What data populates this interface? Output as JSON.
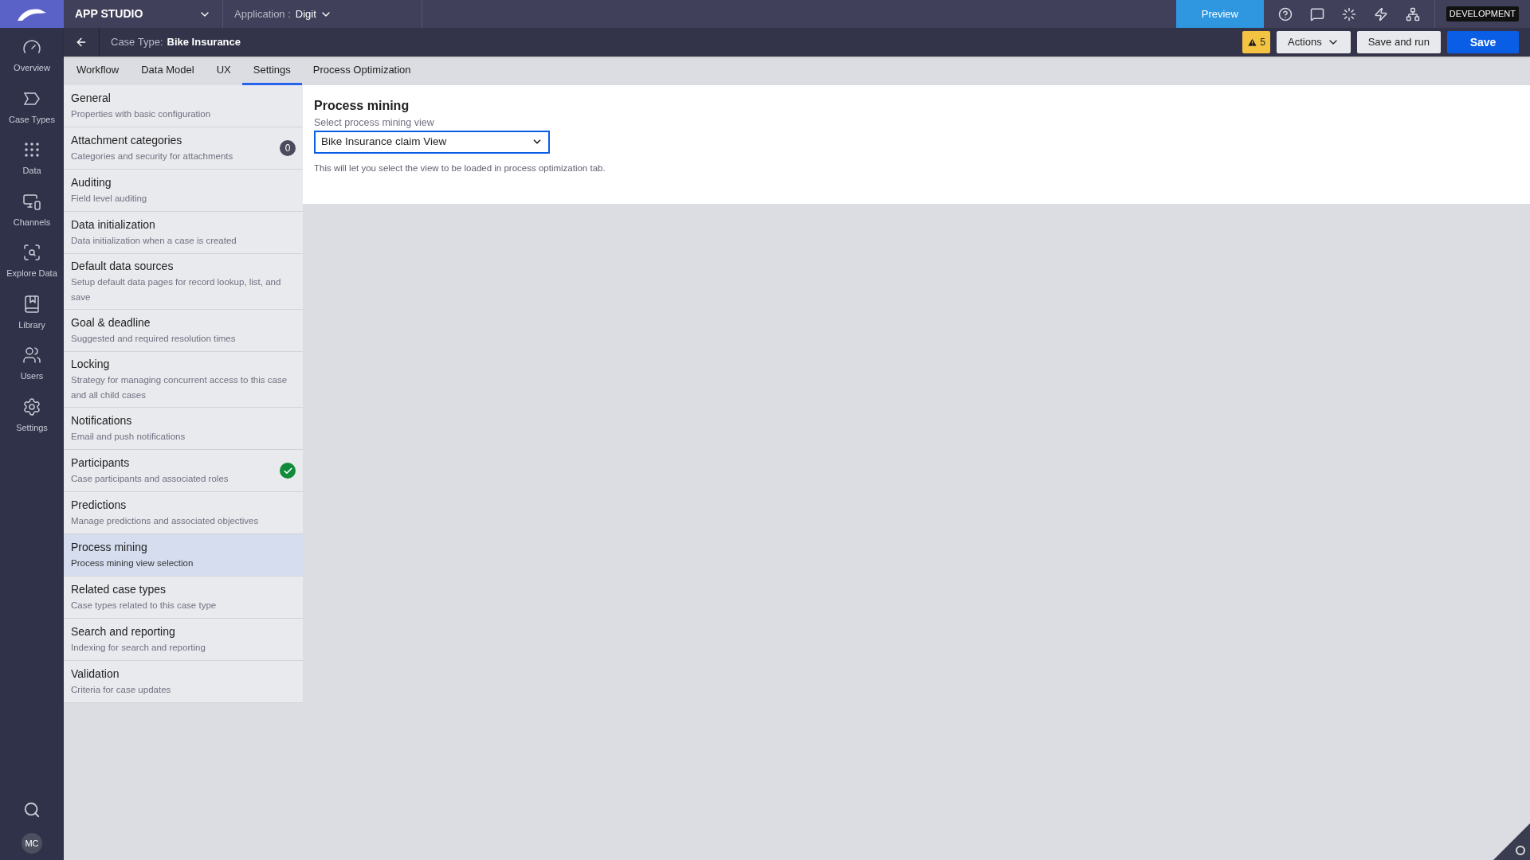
{
  "header": {
    "studio": "APP STUDIO",
    "application_label": "Application :",
    "application": "Digit",
    "preview": "Preview",
    "environment": "DEVELOPMENT"
  },
  "rail": {
    "items": [
      {
        "label": "Overview",
        "kind": "gauge"
      },
      {
        "label": "Case Types",
        "kind": "tag"
      },
      {
        "label": "Data",
        "kind": "grid"
      },
      {
        "label": "Channels",
        "kind": "devices"
      },
      {
        "label": "Explore Data",
        "kind": "explore"
      },
      {
        "label": "Library",
        "kind": "book"
      },
      {
        "label": "Users",
        "kind": "users"
      },
      {
        "label": "Settings",
        "kind": "settings"
      }
    ],
    "avatar": "MC"
  },
  "case_bar": {
    "label": "Case Type:",
    "name": "Bike Insurance",
    "warnings": "5",
    "actions": "Actions",
    "save_and_run": "Save and run",
    "save": "Save"
  },
  "tabs": [
    {
      "label": "Workflow",
      "selected": false
    },
    {
      "label": "Data Model",
      "selected": false
    },
    {
      "label": "UX",
      "selected": false
    },
    {
      "label": "Settings",
      "selected": true
    },
    {
      "label": "Process Optimization",
      "selected": false
    }
  ],
  "settings": [
    {
      "title": "General",
      "description": "Properties with basic configuration",
      "selected": false
    },
    {
      "title": "Attachment categories",
      "description": "Categories and security for attachments",
      "selected": false,
      "badge": {
        "kind": "count",
        "text": "0"
      }
    },
    {
      "title": "Auditing",
      "description": "Field level auditing",
      "selected": false
    },
    {
      "title": "Data initialization",
      "description": "Data initialization when a case is created",
      "selected": false
    },
    {
      "title": "Default data sources",
      "description": "Setup default data pages for record lookup, list, and save",
      "selected": false
    },
    {
      "title": "Goal & deadline",
      "description": "Suggested and required resolution times",
      "selected": false
    },
    {
      "title": "Locking",
      "description": "Strategy for managing concurrent access to this case and all child cases",
      "selected": false
    },
    {
      "title": "Notifications",
      "description": "Email and push notifications",
      "selected": false
    },
    {
      "title": "Participants",
      "description": "Case participants and associated roles",
      "selected": false,
      "badge": {
        "kind": "check"
      }
    },
    {
      "title": "Predictions",
      "description": "Manage predictions and associated objectives",
      "selected": false
    },
    {
      "title": "Process mining",
      "description": "Process mining view selection",
      "selected": true
    },
    {
      "title": "Related case types",
      "description": "Case types related to this case type",
      "selected": false
    },
    {
      "title": "Search and reporting",
      "description": "Indexing for search and reporting",
      "selected": false
    },
    {
      "title": "Validation",
      "description": "Criteria for case updates",
      "selected": false
    }
  ],
  "panel": {
    "title": "Process mining",
    "field_label": "Select process mining view",
    "value": "Bike Insurance claim View",
    "help": "This will let you select the view to be loaded in process optimization tab."
  }
}
